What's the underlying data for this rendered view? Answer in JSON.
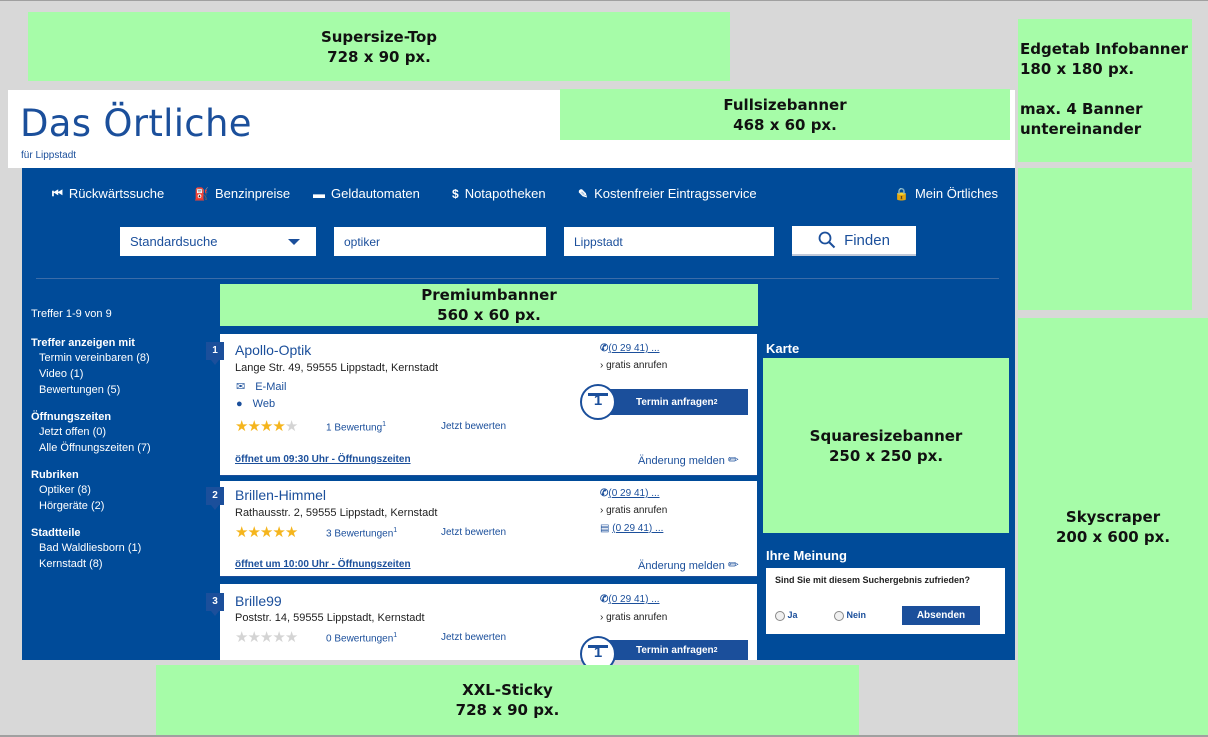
{
  "ads": {
    "supersize_top": {
      "line1": "Supersize-Top",
      "line2": "728 x 90 px."
    },
    "edgetab": {
      "line1": "Edgetab Infobanner",
      "line2": "180 x 180 px.",
      "line3": "max. 4 Banner",
      "line4": "untereinander"
    },
    "fullsize": {
      "line1": "Fullsizebanner",
      "line2": "468 x 60 px."
    },
    "premium": {
      "line1": "Premiumbanner",
      "line2": "560 x 60 px."
    },
    "squaresize": {
      "line1": "Squaresizebanner",
      "line2": "250 x 250 px."
    },
    "skyscraper": {
      "line1": "Skyscraper",
      "line2": "200 x 600 px."
    },
    "xxl_sticky": {
      "line1": "XXL-Sticky",
      "line2": "728 x 90 px."
    }
  },
  "header": {
    "logo": "Das Örtliche",
    "subtitle": "für Lippstadt"
  },
  "nav": {
    "items": [
      "Rückwärtssuche",
      "Benzinpreise",
      "Geldautomaten",
      "Notapotheken",
      "Kostenfreier Eintragsservice"
    ],
    "account": "Mein Örtliches"
  },
  "search": {
    "mode": "Standardsuche",
    "query": "optiker",
    "location": "Lippstadt",
    "submit": "Finden"
  },
  "sidebar": {
    "hits": "Treffer 1-9 von 9",
    "groups": [
      {
        "title": "Treffer anzeigen mit",
        "items": [
          "Termin vereinbaren (8)",
          "Video (1)",
          "Bewertungen (5)"
        ]
      },
      {
        "title": "Öffnungszeiten",
        "items": [
          "Jetzt offen (0)",
          "Alle Öffnungszeiten (7)"
        ]
      },
      {
        "title": "Rubriken",
        "items": [
          "Optiker (8)",
          "Hörgeräte (2)"
        ]
      },
      {
        "title": "Stadtteile",
        "items": [
          "Bad Waldliesborn (1)",
          "Kernstadt (8)"
        ]
      }
    ]
  },
  "results": [
    {
      "num": "1",
      "name": "Apollo-Optik",
      "address": "Lange Str. 49, 59555 Lippstadt, Kernstadt",
      "email": "E-Mail",
      "web": "Web",
      "rating": 4,
      "reviews": "1 Bewertung",
      "review_sup": "1",
      "rate": "Jetzt bewerten",
      "phone": "(0 29 41) ...",
      "free_call": "gratis anrufen",
      "termin": "Termin anfragen",
      "termin_sup": "2",
      "hours": "öffnet um 09:30 Uhr - Öffnungszeiten",
      "report": "Änderung melden"
    },
    {
      "num": "2",
      "name": "Brillen-Himmel",
      "address": "Rathausstr. 2, 59555 Lippstadt, Kernstadt",
      "rating": 5,
      "reviews": "3 Bewertungen",
      "review_sup": "1",
      "rate": "Jetzt bewerten",
      "phone": "(0 29 41) ...",
      "free_call": "gratis anrufen",
      "fax": "(0 29 41) ...",
      "hours": "öffnet um 10:00 Uhr - Öffnungszeiten",
      "report": "Änderung melden"
    },
    {
      "num": "3",
      "name": "Brille99",
      "address": "Poststr. 14, 59555 Lippstadt, Kernstadt",
      "rating": 0,
      "reviews": "0 Bewertungen",
      "review_sup": "1",
      "rate": "Jetzt bewerten",
      "phone": "(0 29 41) ...",
      "free_call": "gratis anrufen",
      "termin": "Termin anfragen",
      "termin_sup": "2"
    }
  ],
  "right": {
    "map_title": "Karte",
    "opinion_title": "Ihre Meinung",
    "question": "Sind Sie mit diesem Suchergebnis zufrieden?",
    "yes": "Ja",
    "no": "Nein",
    "submit": "Absenden"
  },
  "colors": {
    "ad_green": "#a6fca8",
    "brand_blue": "#004b99",
    "link_blue": "#1b4f9b",
    "star": "#f5b51d"
  }
}
